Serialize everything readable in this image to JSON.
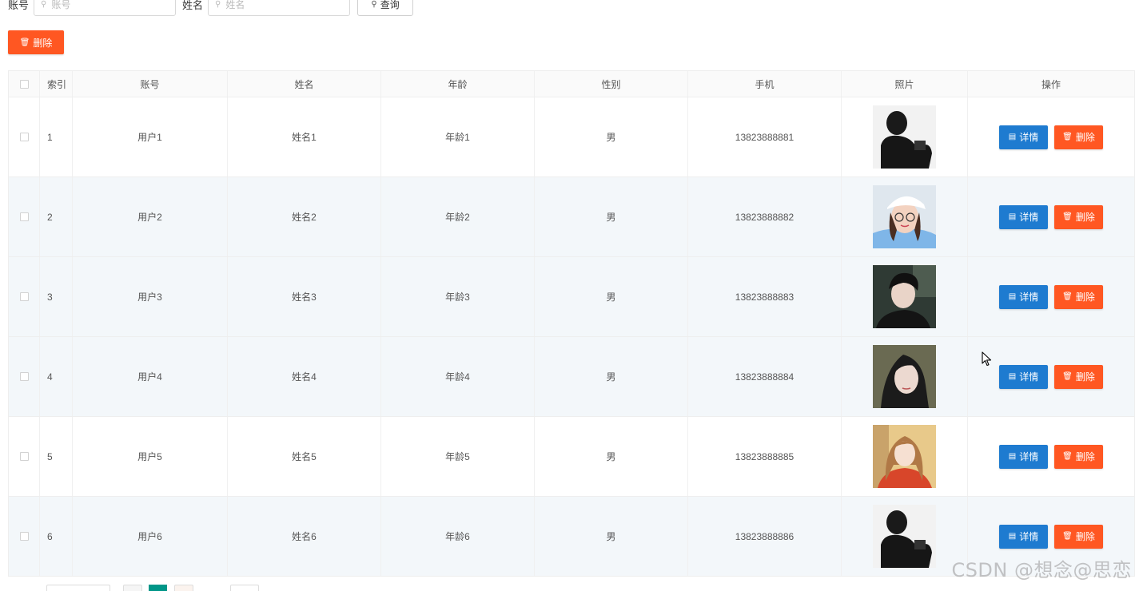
{
  "search": {
    "account_label": "账号",
    "account_placeholder": "账号",
    "name_label": "姓名",
    "name_placeholder": "姓名",
    "query_label": "查询"
  },
  "toolbar": {
    "bulk_delete_label": "删除"
  },
  "table": {
    "headers": [
      "索引",
      "账号",
      "姓名",
      "年龄",
      "性别",
      "手机",
      "照片",
      "操作"
    ],
    "rows": [
      {
        "index": "1",
        "account": "用户1",
        "name": "姓名1",
        "age": "年龄1",
        "gender": "男",
        "phone": "13823888881",
        "photo": "man-silhouette-photo"
      },
      {
        "index": "2",
        "account": "用户2",
        "name": "姓名2",
        "age": "年龄2",
        "gender": "男",
        "phone": "13823888882",
        "photo": "woman-cap-glasses-photo"
      },
      {
        "index": "3",
        "account": "用户3",
        "name": "姓名3",
        "age": "年龄3",
        "gender": "男",
        "phone": "13823888883",
        "photo": "young-man-photo"
      },
      {
        "index": "4",
        "account": "用户4",
        "name": "姓名4",
        "age": "年龄4",
        "gender": "男",
        "phone": "13823888884",
        "photo": "woman-dark-hair-photo"
      },
      {
        "index": "5",
        "account": "用户5",
        "name": "姓名5",
        "age": "年龄5",
        "gender": "男",
        "phone": "13823888885",
        "photo": "woman-red-shirt-photo"
      },
      {
        "index": "6",
        "account": "用户6",
        "name": "姓名6",
        "age": "年龄6",
        "gender": "男",
        "phone": "13823888886",
        "photo": "man-silhouette-photo"
      }
    ],
    "detail_label": "详情",
    "delete_label": "删除"
  },
  "watermark": "CSDN @想念@思恋",
  "colors": {
    "danger": "#ff5722",
    "primary": "#1e7bd0",
    "pager_active": "#009688",
    "row_alt": "#f3f7fa"
  }
}
